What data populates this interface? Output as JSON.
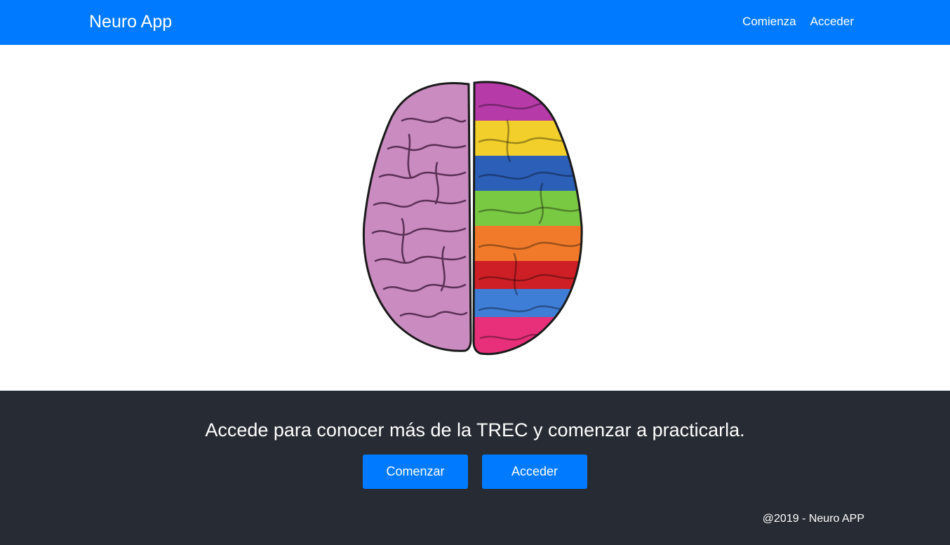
{
  "navbar": {
    "brand": "Neuro App",
    "links": [
      "Comienza",
      "Acceder"
    ]
  },
  "hero": {
    "image_icon": "brain-illustration"
  },
  "footer": {
    "cta_text": "Accede para conocer más de la TREC y comenzar a practicarla.",
    "buttons": [
      "Comenzar",
      "Acceder"
    ],
    "copyright": "@2019 - Neuro APP"
  },
  "colors": {
    "primary": "#007bff",
    "footer_bg": "#272b33",
    "text_light": "#ffffff"
  }
}
